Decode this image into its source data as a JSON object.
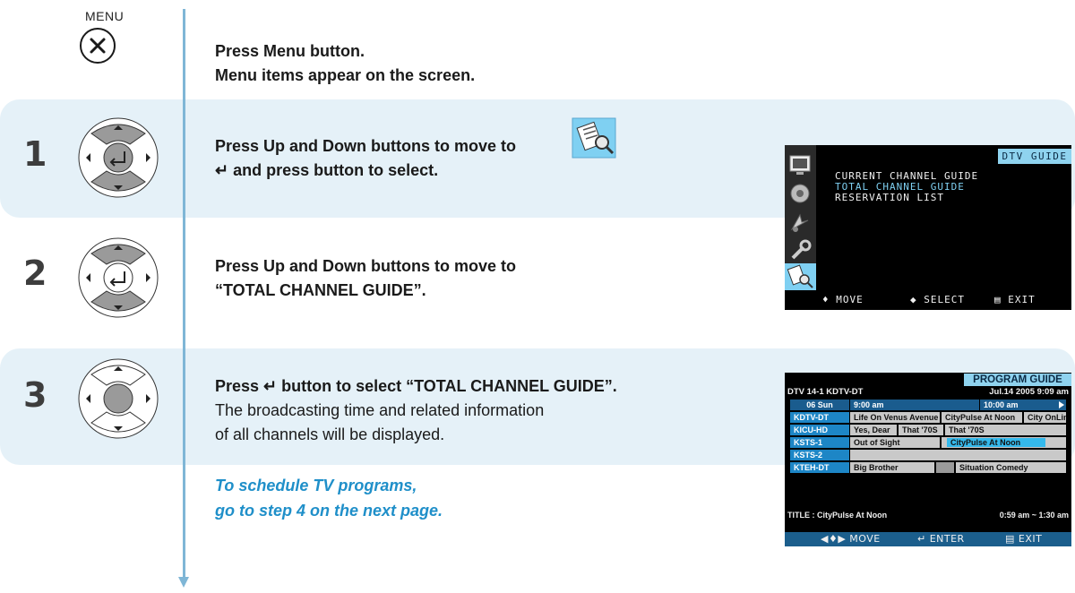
{
  "menu_label": "MENU",
  "intro": {
    "line1": "Press Menu button.",
    "line2": "Menu items appear on the screen."
  },
  "steps": [
    {
      "num": "1",
      "line1": "Press Up and Down buttons to move to",
      "line2": "↵ and press button to select."
    },
    {
      "num": "2",
      "line1": "Press Up and Down buttons to move to",
      "line2": "“TOTAL CHANNEL GUIDE”."
    },
    {
      "num": "3",
      "line1": "Press ↵ button to select “TOTAL CHANNEL GUIDE”.",
      "line2": "The broadcasting time and related information",
      "line3": "of all channels will be displayed."
    }
  ],
  "note": {
    "line1": "To schedule TV programs,",
    "line2": "go to step 4 on the next page."
  },
  "dtv_screen": {
    "header": "DTV GUIDE",
    "options": [
      "CURRENT CHANNEL GUIDE",
      "TOTAL CHANNEL GUIDE",
      "RESERVATION LIST"
    ],
    "selected_index": 1,
    "footer": {
      "move": "♦ MOVE",
      "select": "◆ SELECT",
      "exit": "▤ EXIT"
    }
  },
  "program_guide": {
    "header": "PROGRAM GUIDE",
    "channel_info": "DTV 14-1 KDTV-DT",
    "date_time": "Jul.14  2005  9:09 am",
    "day": "06 Sun",
    "time1": "9:00 am",
    "time2": "10:00 am",
    "channels": [
      "KDTV-DT",
      "KICU-HD",
      "KSTS-1",
      "KSTS-2",
      "KTEH-DT"
    ],
    "programs": {
      "kdtv": [
        "Life On Venus Avenue",
        "CityPulse At Noon",
        "City OnLin"
      ],
      "kicu": [
        "Yes, Dear",
        "That '70S",
        "That '70S"
      ],
      "ksts1": [
        "Out of Sight",
        "CityPulse At Noon"
      ],
      "kteh": [
        "Big Brother",
        "Situation Comedy"
      ]
    },
    "title": "TITLE : CityPulse At Noon",
    "title_time": "0:59 am ~ 1:30 am",
    "footer": {
      "move": "◀♦▶ MOVE",
      "enter": "↵ ENTER",
      "exit": "▤ EXIT"
    },
    "accent_color": "#34b9ec"
  },
  "colors": {
    "band": "#e5f1f8",
    "line": "#7fb6d6",
    "note": "#1f8fc9"
  }
}
